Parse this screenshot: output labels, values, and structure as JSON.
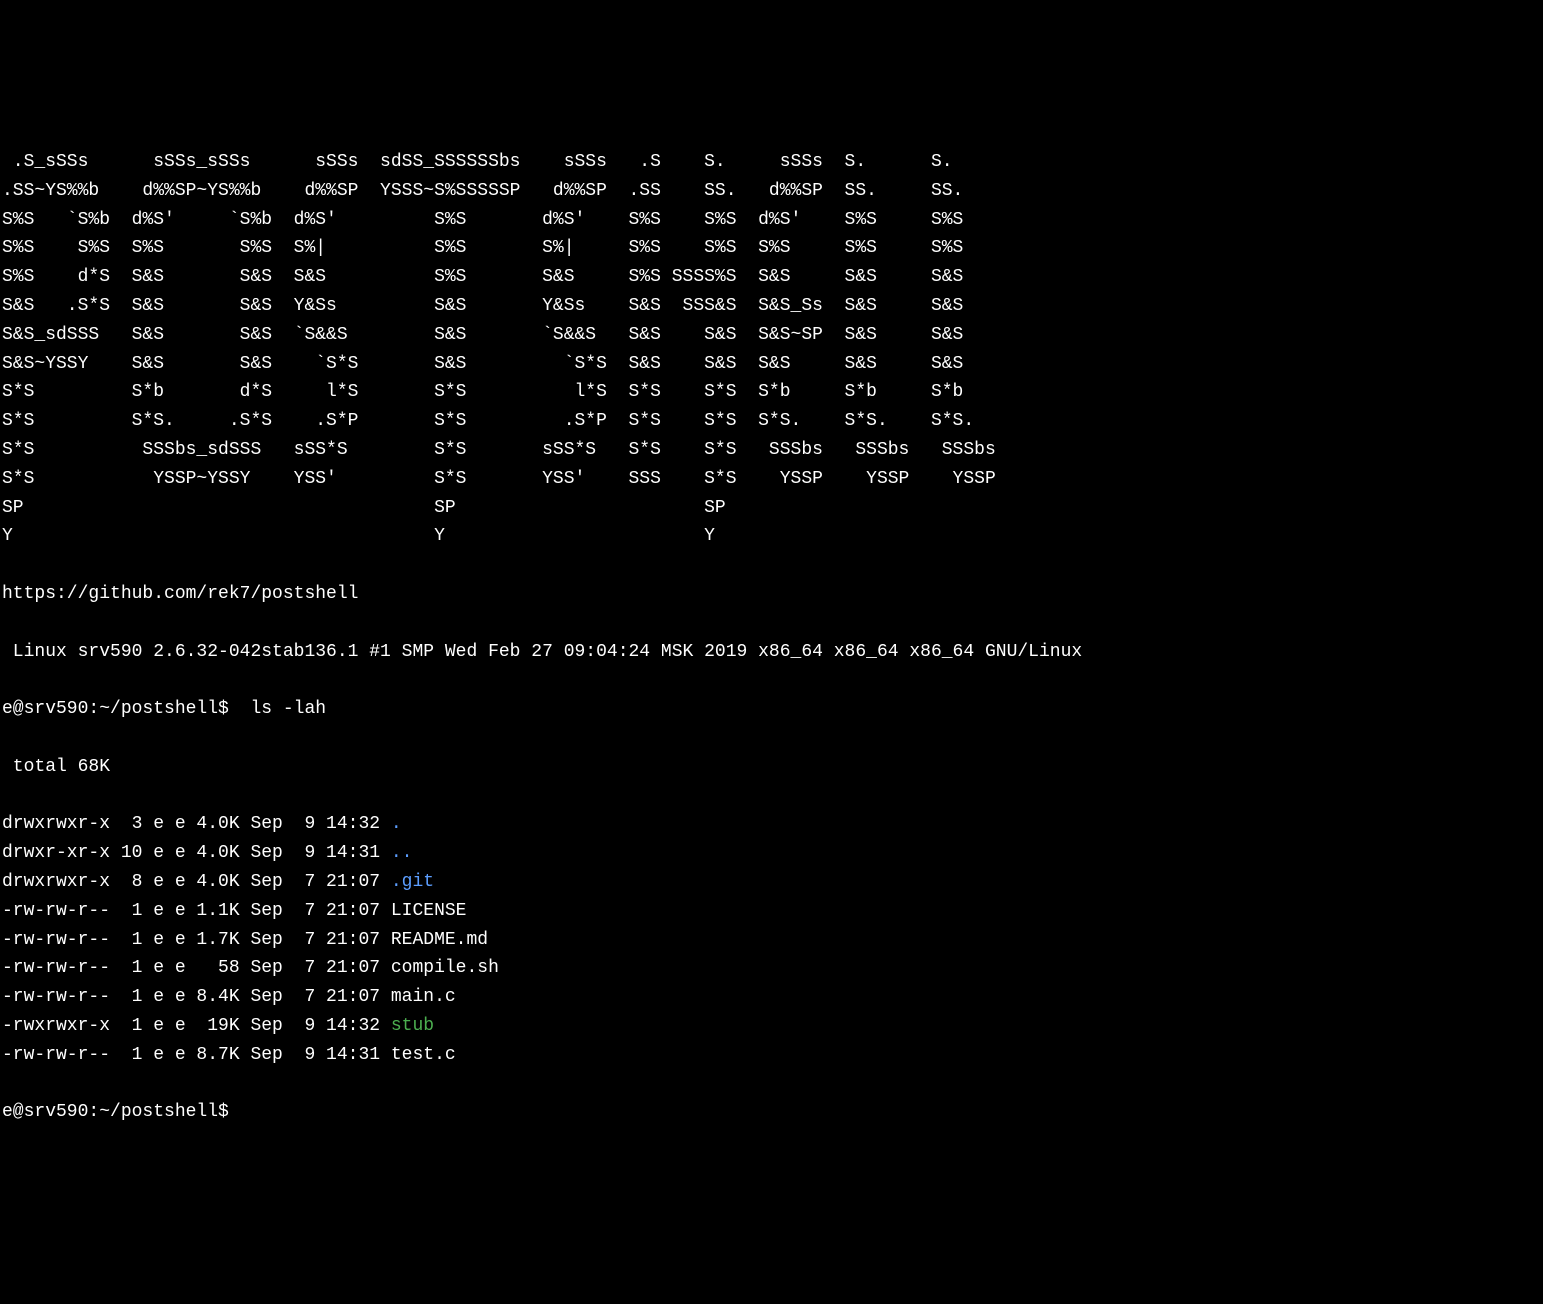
{
  "ascii_art": [
    " .S_sSSs      sSSs_sSSs      sSSs  sdSS_SSSSSSbs    sSSs   .S    S.     sSSs  S.      S.    ",
    ".SS~YS%%b    d%%SP~YS%%b    d%%SP  YSSS~S%SSSSSP   d%%SP  .SS    SS.   d%%SP  SS.     SS.   ",
    "S%S   `S%b  d%S'     `S%b  d%S'         S%S       d%S'    S%S    S%S  d%S'    S%S     S%S   ",
    "S%S    S%S  S%S       S%S  S%|          S%S       S%|     S%S    S%S  S%S     S%S     S%S   ",
    "S%S    d*S  S&S       S&S  S&S          S%S       S&S     S%S SSSS%S  S&S     S&S     S&S   ",
    "S&S   .S*S  S&S       S&S  Y&Ss         S&S       Y&Ss    S&S  SSS&S  S&S_Ss  S&S     S&S   ",
    "S&S_sdSSS   S&S       S&S  `S&&S        S&S       `S&&S   S&S    S&S  S&S~SP  S&S     S&S   ",
    "S&S~YSSY    S&S       S&S    `S*S       S&S         `S*S  S&S    S&S  S&S     S&S     S&S   ",
    "S*S         S*b       d*S     l*S       S*S          l*S  S*S    S*S  S*b     S*b     S*b   ",
    "S*S         S*S.     .S*S    .S*P       S*S         .S*P  S*S    S*S  S*S.    S*S.    S*S.  ",
    "S*S          SSSbs_sdSSS   sSS*S        S*S       sSS*S   S*S    S*S   SSSbs   SSSbs   SSSbs",
    "S*S           YSSP~YSSY    YSS'         S*S       YSS'    SSS    S*S    YSSP    YSSP    YSSP",
    "SP                                      SP                       SP                         ",
    "Y                                       Y                        Y                          "
  ],
  "url": "https://github.com/rek7/postshell",
  "uname": " Linux srv590 2.6.32-042stab136.1 #1 SMP Wed Feb 27 09:04:24 MSK 2019 x86_64 x86_64 x86_64 GNU/Linux",
  "prompt1": "e@srv590:~/postshell$  ",
  "command1": "ls -lah",
  "total": " total 68K",
  "files": [
    {
      "perms": "drwxrwxr-x  3 e e 4.0K Sep  9 14:32 ",
      "name": ".",
      "color": "blue"
    },
    {
      "perms": "drwxr-xr-x 10 e e 4.0K Sep  9 14:31 ",
      "name": "..",
      "color": "blue"
    },
    {
      "perms": "drwxrwxr-x  8 e e 4.0K Sep  7 21:07 ",
      "name": ".git",
      "color": "blue"
    },
    {
      "perms": "-rw-rw-r--  1 e e 1.1K Sep  7 21:07 ",
      "name": "LICENSE",
      "color": ""
    },
    {
      "perms": "-rw-rw-r--  1 e e 1.7K Sep  7 21:07 ",
      "name": "README.md",
      "color": ""
    },
    {
      "perms": "-rw-rw-r--  1 e e   58 Sep  7 21:07 ",
      "name": "compile.sh",
      "color": ""
    },
    {
      "perms": "-rw-rw-r--  1 e e 8.4K Sep  7 21:07 ",
      "name": "main.c",
      "color": ""
    },
    {
      "perms": "-rwxrwxr-x  1 e e  19K Sep  9 14:32 ",
      "name": "stub",
      "color": "green"
    },
    {
      "perms": "-rw-rw-r--  1 e e 8.7K Sep  9 14:31 ",
      "name": "test.c",
      "color": ""
    }
  ],
  "prompt2": "e@srv590:~/postshell$"
}
